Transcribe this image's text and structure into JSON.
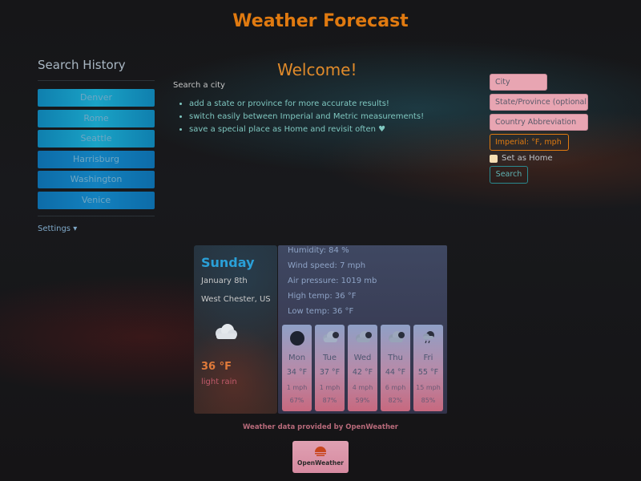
{
  "app": {
    "title": "Weather Forecast"
  },
  "sidebar": {
    "heading": "Search History",
    "history": [
      "Denver",
      "Rome",
      "Seattle",
      "Harrisburg",
      "Washington",
      "Venice"
    ],
    "settings_label": "Settings ▾"
  },
  "intro": {
    "heading": "Welcome!",
    "search_label": "Search a city",
    "tips": [
      "add a state or province for more accurate results!",
      "switch easily between Imperial and Metric measurements!",
      "save a special place as Home and revisit often ♥"
    ]
  },
  "form": {
    "city_placeholder": "City",
    "state_placeholder": "State/Province (optional)",
    "country_placeholder": "Country Abbreviation",
    "units_label": "Imperial: °F, mph",
    "home_label": "Set as Home",
    "search_label": "Search"
  },
  "current": {
    "day": "Sunday",
    "date": "January 8th",
    "location": "West Chester, US",
    "icon": "cloud-icon",
    "temp": "36 °F",
    "description": "light rain"
  },
  "details": {
    "humidity": "Humidity: 84 %",
    "wind": "Wind speed: 7 mph",
    "pressure": "Air pressure: 1019 mb",
    "high": "High temp: 36 °F",
    "low": "Low temp: 36 °F"
  },
  "forecast": [
    {
      "day": "Mon",
      "temp": "34 °F",
      "wind": "1 mph",
      "humidity": "67%",
      "icon": "dark-circle-icon"
    },
    {
      "day": "Tue",
      "temp": "37 °F",
      "wind": "1 mph",
      "humidity": "87%",
      "icon": "cloudy-icon"
    },
    {
      "day": "Wed",
      "temp": "42 °F",
      "wind": "4 mph",
      "humidity": "59%",
      "icon": "cloudy-icon"
    },
    {
      "day": "Thu",
      "temp": "44 °F",
      "wind": "6 mph",
      "humidity": "82%",
      "icon": "cloudy-icon"
    },
    {
      "day": "Fri",
      "temp": "55 °F",
      "wind": "15 mph",
      "humidity": "85%",
      "icon": "rain-icon"
    }
  ],
  "footer": {
    "credit": "Weather data provided by OpenWeather",
    "logo_text": "OpenWeather"
  },
  "colors": {
    "accent": "#e07a10",
    "history_button": "#1496c0",
    "input_bg": "#e8a5b2"
  }
}
